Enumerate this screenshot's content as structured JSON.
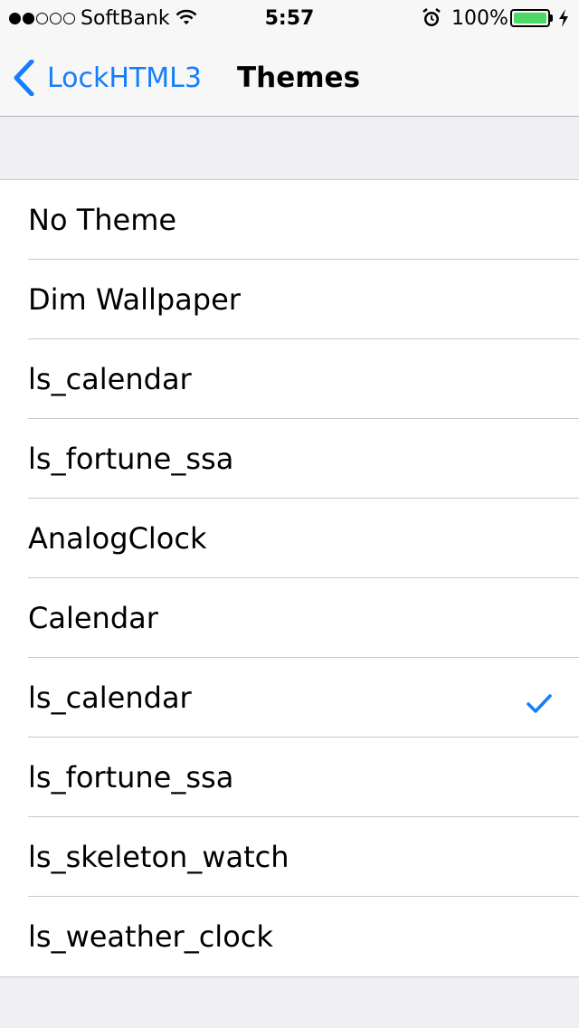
{
  "status_bar": {
    "carrier": "SoftBank",
    "time": "5:57",
    "battery": "100%",
    "battery_level": 1.0,
    "signal_strength": 2
  },
  "nav": {
    "back_label": "LockHTML3",
    "title": "Themes"
  },
  "themes": [
    {
      "label": "No Theme",
      "selected": false
    },
    {
      "label": "Dim Wallpaper",
      "selected": false
    },
    {
      "label": "ls_calendar",
      "selected": false
    },
    {
      "label": "ls_fortune_ssa",
      "selected": false
    },
    {
      "label": "AnalogClock",
      "selected": false
    },
    {
      "label": "Calendar",
      "selected": false
    },
    {
      "label": "ls_calendar",
      "selected": true
    },
    {
      "label": "ls_fortune_ssa",
      "selected": false
    },
    {
      "label": "ls_skeleton_watch",
      "selected": false
    },
    {
      "label": "ls_weather_clock",
      "selected": false
    }
  ],
  "colors": {
    "accent": "#157efb",
    "battery": "#4cd964",
    "background": "#efeff4"
  }
}
